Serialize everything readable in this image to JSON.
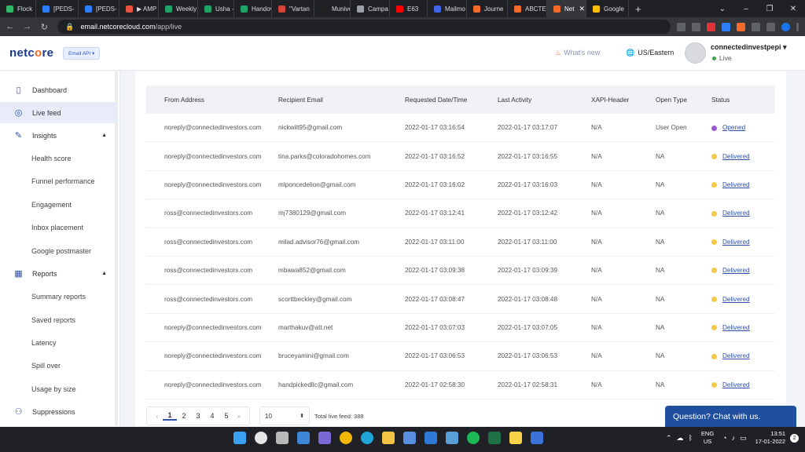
{
  "browser": {
    "tabs": [
      {
        "label": "Flock",
        "color": "#2fb866"
      },
      {
        "label": "[PEDS-",
        "color": "#2d7ff9"
      },
      {
        "label": "[PEDS-",
        "color": "#2d7ff9"
      },
      {
        "label": "▶ AMP",
        "color": "#e8533f"
      },
      {
        "label": "Weekly",
        "color": "#21a366"
      },
      {
        "label": "Usha -",
        "color": "#21a366"
      },
      {
        "label": "Handov",
        "color": "#21a366"
      },
      {
        "label": "\"Vartan",
        "color": "#d64436"
      },
      {
        "label": "Munive",
        "color": "#222222"
      },
      {
        "label": "Campa",
        "color": "#9aa0a6"
      },
      {
        "label": "E63",
        "color": "#ff0000"
      },
      {
        "label": "Mailmo",
        "color": "#3e65e8"
      },
      {
        "label": "Journe",
        "color": "#f26b2a"
      },
      {
        "label": "ABCTE",
        "color": "#f26b2a"
      },
      {
        "label": "Net",
        "color": "#f26b2a"
      },
      {
        "label": "Google",
        "color": "#fbbc05"
      }
    ],
    "url_host": "email.netcorecloud.com",
    "url_path": "/app/live"
  },
  "header": {
    "logo_pre": "netc",
    "logo_oo": "o",
    "logo_post": "re",
    "product": "Email API ▾",
    "whats_new": "What's new",
    "timezone": "US/Eastern",
    "account_name": "connectedinvestpepi ▾",
    "account_status": "Live"
  },
  "sidebar": {
    "items": [
      {
        "label": "Dashboard",
        "icon": "dashboard-icon"
      },
      {
        "label": "Live feed",
        "icon": "live-feed-icon"
      },
      {
        "label": "Insights",
        "icon": "insights-icon"
      },
      {
        "label": "Health score"
      },
      {
        "label": "Funnel performance"
      },
      {
        "label": "Engagement"
      },
      {
        "label": "Inbox placement"
      },
      {
        "label": "Google postmaster"
      },
      {
        "label": "Reports",
        "icon": "reports-icon"
      },
      {
        "label": "Summary reports"
      },
      {
        "label": "Saved reports"
      },
      {
        "label": "Latency"
      },
      {
        "label": "Spill over"
      },
      {
        "label": "Usage by size"
      },
      {
        "label": "Suppressions",
        "icon": "suppressions-icon"
      }
    ]
  },
  "table": {
    "headers": [
      "From Address",
      "Recipient Email",
      "Requested Date/Time",
      "Last Activity",
      "XAPI-Header",
      "Open Type",
      "Status"
    ],
    "rows": [
      {
        "from": "noreply@connectedinvestors.com",
        "to": "nickwilt95@gmail.com",
        "requested": "2022-01-17 03:16:54",
        "last": "2022-01-17 03:17:07",
        "xapi": "N/A",
        "open": "User Open",
        "status": "Opened",
        "status_color": "#9b59d0"
      },
      {
        "from": "noreply@connectedinvestors.com",
        "to": "tina.parks@coloradohomes.com",
        "requested": "2022-01-17 03:16:52",
        "last": "2022-01-17 03:16:55",
        "xapi": "N/A",
        "open": "NA",
        "status": "Delivered",
        "status_color": "#f7c948"
      },
      {
        "from": "noreply@connectedinvestors.com",
        "to": "mlponcedelion@gmail.com",
        "requested": "2022-01-17 03:16:02",
        "last": "2022-01-17 03:16:03",
        "xapi": "N/A",
        "open": "NA",
        "status": "Delivered",
        "status_color": "#f7c948"
      },
      {
        "from": "ross@connectedinvestors.com",
        "to": "mj7380129@gmail.com",
        "requested": "2022-01-17 03:12:41",
        "last": "2022-01-17 03:12:42",
        "xapi": "N/A",
        "open": "NA",
        "status": "Delivered",
        "status_color": "#f7c948"
      },
      {
        "from": "ross@connectedinvestors.com",
        "to": "milad.advisor76@gmail.com",
        "requested": "2022-01-17 03:11:00",
        "last": "2022-01-17 03:11:00",
        "xapi": "N/A",
        "open": "NA",
        "status": "Delivered",
        "status_color": "#f7c948"
      },
      {
        "from": "ross@connectedinvestors.com",
        "to": "mbawa852@gmail.com",
        "requested": "2022-01-17 03:09:38",
        "last": "2022-01-17 03:09:39",
        "xapi": "N/A",
        "open": "NA",
        "status": "Delivered",
        "status_color": "#f7c948"
      },
      {
        "from": "ross@connectedinvestors.com",
        "to": "scorttbeckley@gmail.com",
        "requested": "2022-01-17 03:08:47",
        "last": "2022-01-17 03:08:48",
        "xapi": "N/A",
        "open": "NA",
        "status": "Delivered",
        "status_color": "#f7c948"
      },
      {
        "from": "noreply@connectedinvestors.com",
        "to": "marthakuv@att.net",
        "requested": "2022-01-17 03:07:03",
        "last": "2022-01-17 03:07:05",
        "xapi": "N/A",
        "open": "NA",
        "status": "Delivered",
        "status_color": "#f7c948"
      },
      {
        "from": "noreply@connectedinvestors.com",
        "to": "bruceyamini@gmail.com",
        "requested": "2022-01-17 03:06:53",
        "last": "2022-01-17 03:06:53",
        "xapi": "N/A",
        "open": "NA",
        "status": "Delivered",
        "status_color": "#f7c948"
      },
      {
        "from": "noreply@connectedinvestors.com",
        "to": "handpickedllc@gmail.com",
        "requested": "2022-01-17 02:58:30",
        "last": "2022-01-17 02:58:31",
        "xapi": "N/A",
        "open": "NA",
        "status": "Delivered",
        "status_color": "#f7c948"
      }
    ]
  },
  "pagination": {
    "prev": "‹",
    "pages": [
      "1",
      "2",
      "3",
      "4",
      "5"
    ],
    "next": "»",
    "page_size": "10",
    "total": "Total live feed: 388"
  },
  "chat": {
    "label": "Question? Chat with us."
  },
  "taskbar": {
    "lang_top": "ENG",
    "lang_bottom": "US",
    "time": "13:51",
    "date": "17-01-2022",
    "notifications": "2"
  }
}
